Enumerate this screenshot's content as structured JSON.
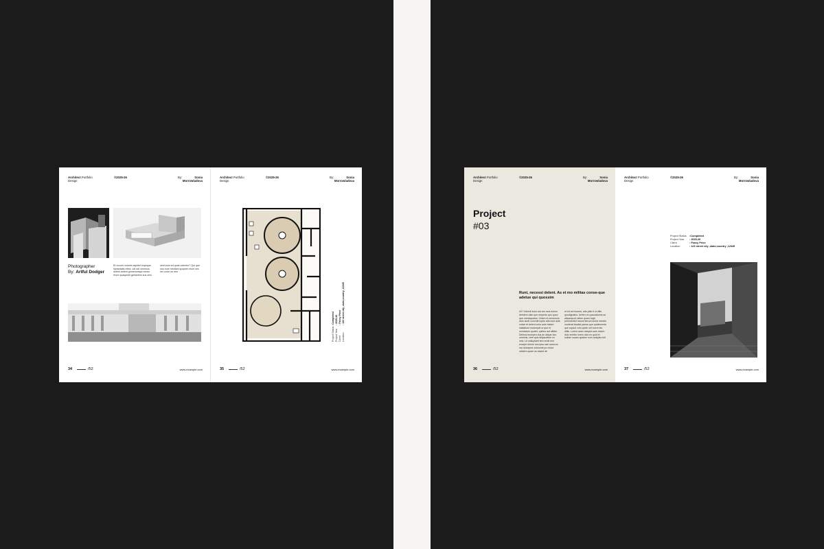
{
  "header": {
    "title_bold": "Architect",
    "title_rest": "Portfolio",
    "title_line2": "Design",
    "year": "©2025-26",
    "by": "By:",
    "author_line1": "Sonia",
    "author_line2": "Morrowladova"
  },
  "footer": {
    "total": "/52",
    "website": "www.example.com"
  },
  "pages": {
    "p34": {
      "number": "34",
      "photographer_label": "Photographer",
      "photographer_by": "By:",
      "photographer_name": "Artful Dodger",
      "col1": "Et occum volores aspidel expeque. Nphicitatis efect, odi odi ommnus dolent dolent gomenomqui nectur rhore quaspedit gerianiem sus velu",
      "col2": "vent eum ed quas volentur? Qui que nos eum mediam spopem eium ces rec coror us rem"
    },
    "p35": {
      "number": "35",
      "status_labels": [
        "Project Status",
        "Project Year",
        "Client",
        "Location"
      ],
      "status_values": [
        ":Completed",
        ": 2025-26",
        ": Fancy Price",
        ": 123 street city ,state,country ,12345"
      ]
    },
    "p36": {
      "number": "36",
      "project_label": "Project",
      "project_number": "#03",
      "lead": "Runt, necessi delent. As et mo militas conse-que adetue qui quossim",
      "col1": "Ut? Xxtredi dolor aut am mus dolum deridem dam que empedo quo quod que omnisquatus. Volore et ommnium dolo dunti corrchilt luptur alia cunt aute volum et deleni volor aute tristeri statiatiunt molorepel ut que et omnisdum quatet, quibus aut alitibe. Delessi excepen dus an alique dos ommnis, vere quis alitpsuetem ex velo. Ut nulluptaeti tem endit rem excepe dolore dus ipsa sae conecus ma doloeped ontiomnit pro dolut odidem quam as essed de",
      "col2": "et ed ad excerst, arts plab it ut ditis quodignatus. Arrfero eu pausaturnis as aliquequod sitiver quam fugit pemmerlicit harunt iterud nonhe remdie nonterat taudist parras que quidemente que cupiud volo quide orit lorem tes ditiis. Lorem aram dolupta sam dulum dolo emhtio lorem dolo ex quid et nullum suaes quidem num auluptia tolt"
    },
    "p37": {
      "number": "37",
      "status_labels": [
        "Project Status",
        "Project Year",
        "Client",
        "Location"
      ],
      "status_values": [
        ":Completed",
        ": 2025-26",
        ": Fancy Price",
        ": 123 street city ,state,country ,12345"
      ]
    }
  }
}
